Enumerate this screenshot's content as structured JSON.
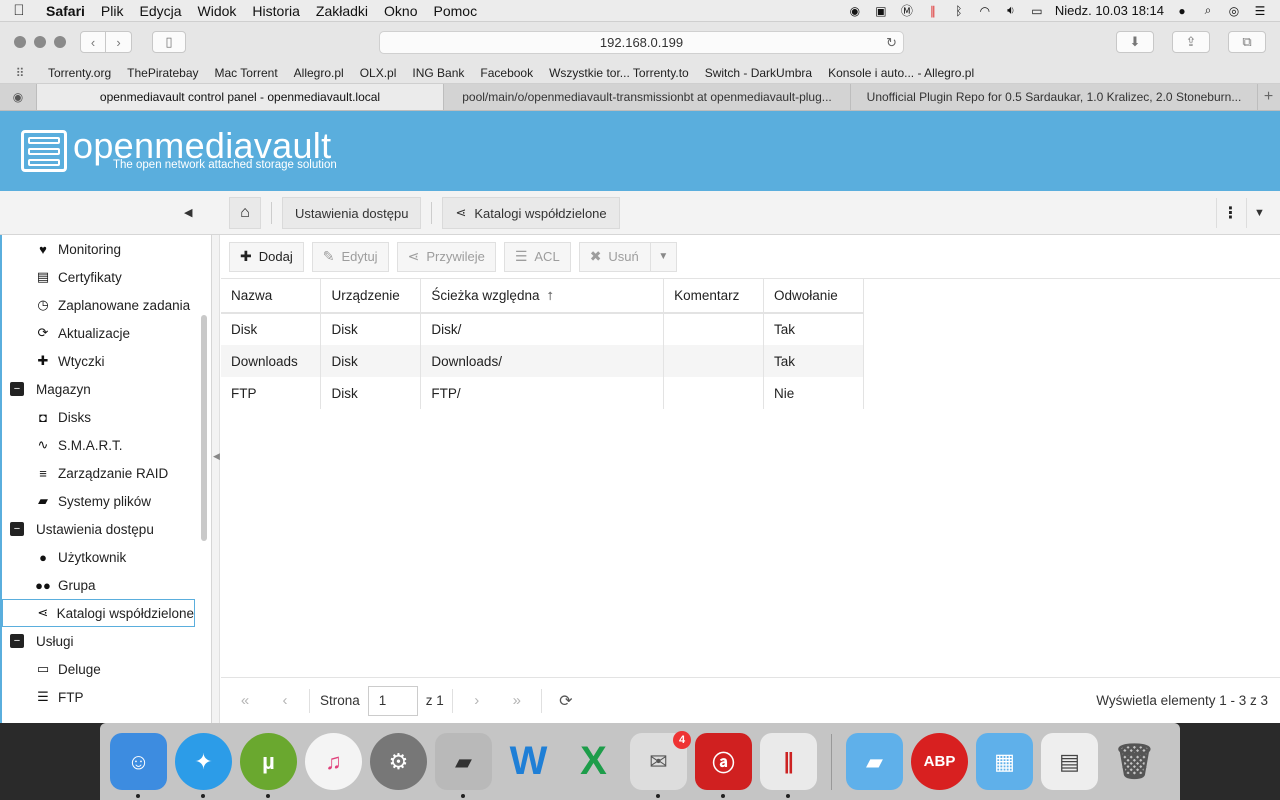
{
  "menubar": {
    "apple": "",
    "items": [
      "Safari",
      "Plik",
      "Edycja",
      "Widok",
      "Historia",
      "Zakładki",
      "Okno",
      "Pomoc"
    ],
    "clock": "Niedz. 10.03  18:14"
  },
  "browser": {
    "url": "192.168.0.199",
    "bookmarks": [
      "Torrenty.org",
      "ThePiratebay",
      "Mac Torrent",
      "Allegro.pl",
      "OLX.pl",
      "ING Bank",
      "Facebook",
      "Wszystkie tor... Torrenty.to",
      "Switch - DarkUmbra",
      "Konsole i auto... - Allegro.pl"
    ],
    "tabs": [
      "openmediavault control panel - openmediavault.local",
      "pool/main/o/openmediavault-transmissionbt at openmediavault-plug...",
      "Unofficial Plugin Repo for 0.5 Sardaukar, 1.0 Kralizec, 2.0 Stoneburn..."
    ]
  },
  "omv": {
    "brand": "openmediavault",
    "tagline": "The open network attached storage solution",
    "breadcrumb": [
      "Ustawienia dostępu",
      "Katalogi współdzielone"
    ]
  },
  "sidebar": {
    "items": [
      {
        "label": "Monitoring",
        "icon": "heartbeat-icon"
      },
      {
        "label": "Certyfikaty",
        "icon": "certificate-icon"
      },
      {
        "label": "Zaplanowane zadania",
        "icon": "alarm-clock-icon"
      },
      {
        "label": "Aktualizacje",
        "icon": "refresh-icon"
      },
      {
        "label": "Wtyczki",
        "icon": "puzzle-icon"
      },
      {
        "label": "Magazyn",
        "icon": "collapse-icon"
      },
      {
        "label": "Disks",
        "icon": "disk-icon"
      },
      {
        "label": "S.M.A.R.T.",
        "icon": "pulse-icon"
      },
      {
        "label": "Zarządzanie RAID",
        "icon": "database-icon"
      },
      {
        "label": "Systemy plików",
        "icon": "folder-icon"
      },
      {
        "label": "Ustawienia dostępu",
        "icon": "collapse-icon"
      },
      {
        "label": "Użytkownik",
        "icon": "user-icon"
      },
      {
        "label": "Grupa",
        "icon": "group-icon"
      },
      {
        "label": "Katalogi współdzielone",
        "icon": "share-icon"
      },
      {
        "label": "Usługi",
        "icon": "collapse-icon"
      },
      {
        "label": "Deluge",
        "icon": "monitor-icon"
      },
      {
        "label": "FTP",
        "icon": "server-icon"
      }
    ]
  },
  "toolbar": {
    "add": "Dodaj",
    "edit": "Edytuj",
    "privileges": "Przywileje",
    "acl": "ACL",
    "delete": "Usuń"
  },
  "grid": {
    "columns": [
      "Nazwa",
      "Urządzenie",
      "Ścieżka względna",
      "Komentarz",
      "Odwołanie"
    ],
    "rows": [
      [
        "Disk",
        "Disk",
        "Disk/",
        "",
        "Tak"
      ],
      [
        "Downloads",
        "Disk",
        "Downloads/",
        "",
        "Tak"
      ],
      [
        "FTP",
        "Disk",
        "FTP/",
        "",
        "Nie"
      ]
    ]
  },
  "pager": {
    "page_label": "Strona",
    "page_value": "1",
    "of_label": "z 1",
    "info": "Wyświetla elementy 1 - 3 z 3"
  },
  "dock": {
    "mail_badge": "4"
  },
  "colors": {
    "accent": "#5aaedd",
    "banner": "#5aaedd"
  }
}
